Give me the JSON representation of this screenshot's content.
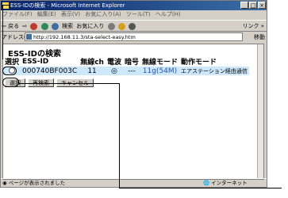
{
  "window": {
    "title": "ESS-IDの検索 - Microsoft Internet Explorer",
    "controls": [
      "_",
      "□",
      "×"
    ]
  },
  "menu": [
    "ファイル(F)",
    "編集(E)",
    "表示(V)",
    "お気に入り(A)",
    "ツール(T)",
    "ヘルプ(H)"
  ],
  "toolbar": {
    "back": "⇦ 戻る",
    "search": "検索",
    "favorites": "お気に入り",
    "links": "リンク »"
  },
  "address": {
    "label": "アドレス(D)",
    "url": "http://192.168.11.3/sta-select-easy.htm",
    "go": "移動"
  },
  "page": {
    "heading": "ESS-IDの検索",
    "columns": [
      "選択",
      "ESS-ID",
      "無線ch",
      "電波",
      "暗号",
      "無線モード",
      "動作モード"
    ],
    "rows": [
      {
        "essid": "000740BF003C",
        "channel": "11",
        "signal": "◎",
        "crypto": "---",
        "mode": "11g(54M)",
        "operation": "エアステーション経由通信"
      }
    ],
    "buttons": {
      "select": "選択",
      "research": "再検索",
      "cancel": "キャンセル"
    }
  },
  "status": {
    "left": "ページが表示されました",
    "zone": "インターネット"
  }
}
